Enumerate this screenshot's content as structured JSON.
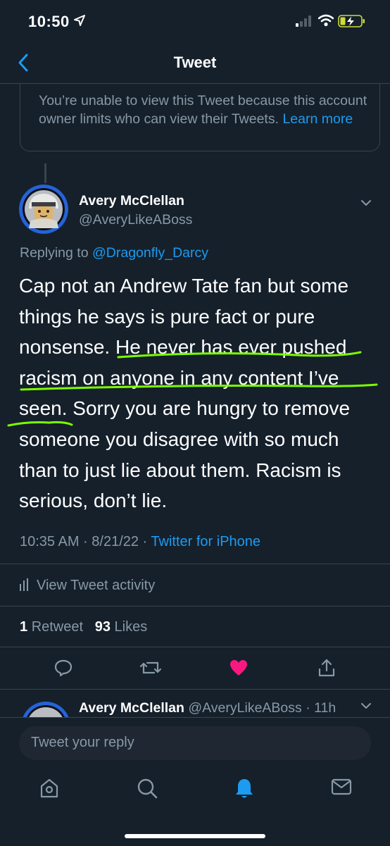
{
  "status_bar": {
    "time": "10:50"
  },
  "header": {
    "title": "Tweet"
  },
  "notice": {
    "text": "You’re unable to view this Tweet because this account owner limits who can view their Tweets.",
    "link": "Learn more"
  },
  "tweet": {
    "author_name": "Avery McClellan",
    "author_handle": "@AveryLikeABoss",
    "replying_to_label": "Replying to",
    "replying_to_handle": "@Dragonfly_Darcy",
    "text_lines": [
      "Cap not an Andrew Tate fan but some",
      "things he says is pure fact or pure",
      "nonsense. He never has ever pushed",
      "racism on anyone in any content I’ve",
      "seen. Sorry you are hungry to remove",
      "someone you disagree with so much",
      "than to just lie about them. Racism is",
      "serious, don’t lie."
    ],
    "timestamp": "10:35 AM · 8/21/22 · ",
    "source": "Twitter for iPhone",
    "activity_label": "View Tweet activity",
    "retweets_count": "1",
    "retweets_label": "Retweet",
    "likes_count": "93",
    "likes_label": "Likes",
    "liked": true
  },
  "reply": {
    "author_name": "Avery McClellan",
    "author_handle": "@AveryLikeABoss · 11h"
  },
  "composer": {
    "placeholder": "Tweet your reply"
  },
  "tabs": [
    "home",
    "search",
    "notifications",
    "messages"
  ],
  "colors": {
    "background": "#15202b",
    "accent": "#1d9bf0",
    "like": "#f91880",
    "highlight": "#7cfc00"
  }
}
